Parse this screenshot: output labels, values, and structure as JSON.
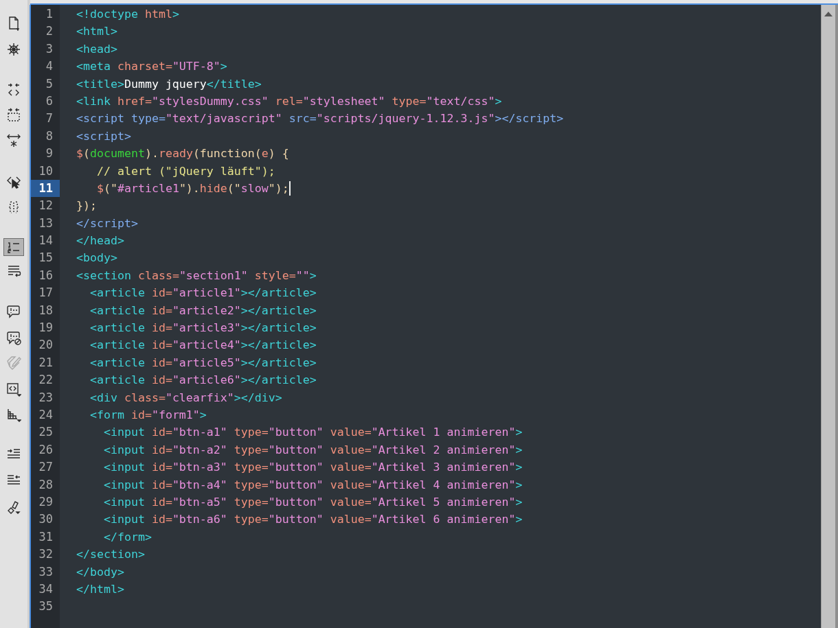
{
  "toolbar": [
    {
      "selected": false,
      "disabled": false
    },
    {
      "selected": false,
      "disabled": false
    },
    {
      "selected": false,
      "disabled": false
    },
    {
      "selected": false,
      "disabled": false
    },
    {
      "selected": false,
      "disabled": false
    },
    {
      "selected": false,
      "disabled": false
    },
    {
      "selected": false,
      "disabled": false
    },
    {
      "selected": true,
      "disabled": false
    },
    {
      "selected": false,
      "disabled": false
    },
    {
      "selected": false,
      "disabled": false
    },
    {
      "selected": false,
      "disabled": false
    },
    {
      "selected": false,
      "disabled": true
    },
    {
      "selected": false,
      "disabled": false
    },
    {
      "selected": false,
      "disabled": false
    },
    {
      "selected": false,
      "disabled": false
    },
    {
      "selected": false,
      "disabled": false
    },
    {
      "selected": false,
      "disabled": false
    }
  ],
  "lines": [
    {
      "number": "1",
      "selected": false,
      "tokens": [
        {
          "text": "<!doctype",
          "kind": "tag"
        },
        {
          "text": " html",
          "kind": "attr"
        },
        {
          "text": ">",
          "kind": "tag"
        }
      ]
    },
    {
      "number": "2",
      "selected": false,
      "tokens": [
        {
          "text": "<html>",
          "kind": "tag"
        }
      ]
    },
    {
      "number": "3",
      "selected": false,
      "tokens": [
        {
          "text": "<head>",
          "kind": "tag"
        }
      ]
    },
    {
      "number": "4",
      "selected": false,
      "tokens": [
        {
          "text": "<meta",
          "kind": "tag"
        },
        {
          "text": " charset=",
          "kind": "attr"
        },
        {
          "text": "\"UTF-8\"",
          "kind": "str"
        },
        {
          "text": ">",
          "kind": "tag"
        }
      ]
    },
    {
      "number": "5",
      "selected": false,
      "tokens": [
        {
          "text": "<title>",
          "kind": "tag"
        },
        {
          "text": "Dummy jquery",
          "kind": "plain"
        },
        {
          "text": "</title>",
          "kind": "tag"
        }
      ]
    },
    {
      "number": "6",
      "selected": false,
      "tokens": [
        {
          "text": "<link",
          "kind": "tag"
        },
        {
          "text": " href=",
          "kind": "attr"
        },
        {
          "text": "\"stylesDummy.css\"",
          "kind": "str"
        },
        {
          "text": " rel=",
          "kind": "attr"
        },
        {
          "text": "\"stylesheet\"",
          "kind": "str"
        },
        {
          "text": " type=",
          "kind": "attr"
        },
        {
          "text": "\"text/css\"",
          "kind": "str"
        },
        {
          "text": ">",
          "kind": "tag"
        }
      ]
    },
    {
      "number": "7",
      "selected": false,
      "tokens": [
        {
          "text": "<script type=",
          "kind": "script"
        },
        {
          "text": "\"text/javascript\"",
          "kind": "str"
        },
        {
          "text": " src=",
          "kind": "script"
        },
        {
          "text": "\"scripts/jquery-1.12.3.js\"",
          "kind": "str"
        },
        {
          "text": "></script>",
          "kind": "script"
        }
      ]
    },
    {
      "number": "8",
      "selected": false,
      "tokens": [
        {
          "text": "<script>",
          "kind": "script"
        }
      ]
    },
    {
      "number": "9",
      "selected": false,
      "tokens": [
        {
          "text": "$",
          "kind": "ident"
        },
        {
          "text": "(",
          "kind": "js"
        },
        {
          "text": "document",
          "kind": "dom"
        },
        {
          "text": ").",
          "kind": "js"
        },
        {
          "text": "ready",
          "kind": "ident"
        },
        {
          "text": "(function(",
          "kind": "js"
        },
        {
          "text": "e",
          "kind": "ident"
        },
        {
          "text": ") {",
          "kind": "js"
        }
      ]
    },
    {
      "number": "10",
      "selected": false,
      "tokens": [
        {
          "text": "   // alert (\"jQuery läuft\");",
          "kind": "comment"
        }
      ]
    },
    {
      "number": "11",
      "selected": true,
      "tokens": [
        {
          "text": "   $",
          "kind": "ident"
        },
        {
          "text": "(\"",
          "kind": "js"
        },
        {
          "text": "#article1",
          "kind": "str"
        },
        {
          "text": "\").",
          "kind": "js"
        },
        {
          "text": "hide",
          "kind": "ident"
        },
        {
          "text": "(\"",
          "kind": "js"
        },
        {
          "text": "slow",
          "kind": "str"
        },
        {
          "text": "\");",
          "kind": "js"
        }
      ]
    },
    {
      "number": "12",
      "selected": false,
      "tokens": [
        {
          "text": "});",
          "kind": "js"
        }
      ]
    },
    {
      "number": "13",
      "selected": false,
      "tokens": [
        {
          "text": "</script>",
          "kind": "script"
        }
      ]
    },
    {
      "number": "14",
      "selected": false,
      "tokens": [
        {
          "text": "</head>",
          "kind": "tag"
        }
      ]
    },
    {
      "number": "15",
      "selected": false,
      "tokens": [
        {
          "text": "<body>",
          "kind": "tag"
        }
      ]
    },
    {
      "number": "16",
      "selected": false,
      "tokens": [
        {
          "text": "<section",
          "kind": "tag"
        },
        {
          "text": " class=",
          "kind": "attr"
        },
        {
          "text": "\"section1\"",
          "kind": "str"
        },
        {
          "text": " style=",
          "kind": "attr"
        },
        {
          "text": "\"\"",
          "kind": "str"
        },
        {
          "text": ">",
          "kind": "tag"
        }
      ]
    },
    {
      "number": "17",
      "selected": false,
      "tokens": [
        {
          "text": "  <article",
          "kind": "tag"
        },
        {
          "text": " id=",
          "kind": "attr"
        },
        {
          "text": "\"article1\"",
          "kind": "str"
        },
        {
          "text": "></article>",
          "kind": "tag"
        }
      ]
    },
    {
      "number": "18",
      "selected": false,
      "tokens": [
        {
          "text": "  <article",
          "kind": "tag"
        },
        {
          "text": " id=",
          "kind": "attr"
        },
        {
          "text": "\"article2\"",
          "kind": "str"
        },
        {
          "text": "></article>",
          "kind": "tag"
        }
      ]
    },
    {
      "number": "19",
      "selected": false,
      "tokens": [
        {
          "text": "  <article",
          "kind": "tag"
        },
        {
          "text": " id=",
          "kind": "attr"
        },
        {
          "text": "\"article3\"",
          "kind": "str"
        },
        {
          "text": "></article>",
          "kind": "tag"
        }
      ]
    },
    {
      "number": "20",
      "selected": false,
      "tokens": [
        {
          "text": "  <article",
          "kind": "tag"
        },
        {
          "text": " id=",
          "kind": "attr"
        },
        {
          "text": "\"article4\"",
          "kind": "str"
        },
        {
          "text": "></article>",
          "kind": "tag"
        }
      ]
    },
    {
      "number": "21",
      "selected": false,
      "tokens": [
        {
          "text": "  <article",
          "kind": "tag"
        },
        {
          "text": " id=",
          "kind": "attr"
        },
        {
          "text": "\"article5\"",
          "kind": "str"
        },
        {
          "text": "></article>",
          "kind": "tag"
        }
      ]
    },
    {
      "number": "22",
      "selected": false,
      "tokens": [
        {
          "text": "  <article",
          "kind": "tag"
        },
        {
          "text": " id=",
          "kind": "attr"
        },
        {
          "text": "\"article6\"",
          "kind": "str"
        },
        {
          "text": "></article>",
          "kind": "tag"
        }
      ]
    },
    {
      "number": "23",
      "selected": false,
      "tokens": [
        {
          "text": "  <div",
          "kind": "tag"
        },
        {
          "text": " class=",
          "kind": "attr"
        },
        {
          "text": "\"clearfix\"",
          "kind": "str"
        },
        {
          "text": "></div>",
          "kind": "tag"
        }
      ]
    },
    {
      "number": "24",
      "selected": false,
      "tokens": [
        {
          "text": "  <form",
          "kind": "tag"
        },
        {
          "text": " id=",
          "kind": "attr"
        },
        {
          "text": "\"form1\"",
          "kind": "str"
        },
        {
          "text": ">",
          "kind": "tag"
        }
      ]
    },
    {
      "number": "25",
      "selected": false,
      "tokens": [
        {
          "text": "    <input",
          "kind": "tag"
        },
        {
          "text": " id=",
          "kind": "attr"
        },
        {
          "text": "\"btn-a1\"",
          "kind": "str"
        },
        {
          "text": " type=",
          "kind": "attr"
        },
        {
          "text": "\"button\"",
          "kind": "str"
        },
        {
          "text": " value=",
          "kind": "attr"
        },
        {
          "text": "\"Artikel 1 animieren\"",
          "kind": "str"
        },
        {
          "text": ">",
          "kind": "tag"
        }
      ]
    },
    {
      "number": "26",
      "selected": false,
      "tokens": [
        {
          "text": "    <input",
          "kind": "tag"
        },
        {
          "text": " id=",
          "kind": "attr"
        },
        {
          "text": "\"btn-a2\"",
          "kind": "str"
        },
        {
          "text": " type=",
          "kind": "attr"
        },
        {
          "text": "\"button\"",
          "kind": "str"
        },
        {
          "text": " value=",
          "kind": "attr"
        },
        {
          "text": "\"Artikel 2 animieren\"",
          "kind": "str"
        },
        {
          "text": ">",
          "kind": "tag"
        }
      ]
    },
    {
      "number": "27",
      "selected": false,
      "tokens": [
        {
          "text": "    <input",
          "kind": "tag"
        },
        {
          "text": " id=",
          "kind": "attr"
        },
        {
          "text": "\"btn-a3\"",
          "kind": "str"
        },
        {
          "text": " type=",
          "kind": "attr"
        },
        {
          "text": "\"button\"",
          "kind": "str"
        },
        {
          "text": " value=",
          "kind": "attr"
        },
        {
          "text": "\"Artikel 3 animieren\"",
          "kind": "str"
        },
        {
          "text": ">",
          "kind": "tag"
        }
      ]
    },
    {
      "number": "28",
      "selected": false,
      "tokens": [
        {
          "text": "    <input",
          "kind": "tag"
        },
        {
          "text": " id=",
          "kind": "attr"
        },
        {
          "text": "\"btn-a4\"",
          "kind": "str"
        },
        {
          "text": " type=",
          "kind": "attr"
        },
        {
          "text": "\"button\"",
          "kind": "str"
        },
        {
          "text": " value=",
          "kind": "attr"
        },
        {
          "text": "\"Artikel 4 animieren\"",
          "kind": "str"
        },
        {
          "text": ">",
          "kind": "tag"
        }
      ]
    },
    {
      "number": "29",
      "selected": false,
      "tokens": [
        {
          "text": "    <input",
          "kind": "tag"
        },
        {
          "text": " id=",
          "kind": "attr"
        },
        {
          "text": "\"btn-a5\"",
          "kind": "str"
        },
        {
          "text": " type=",
          "kind": "attr"
        },
        {
          "text": "\"button\"",
          "kind": "str"
        },
        {
          "text": " value=",
          "kind": "attr"
        },
        {
          "text": "\"Artikel 5 animieren\"",
          "kind": "str"
        },
        {
          "text": ">",
          "kind": "tag"
        }
      ]
    },
    {
      "number": "30",
      "selected": false,
      "tokens": [
        {
          "text": "    <input",
          "kind": "tag"
        },
        {
          "text": " id=",
          "kind": "attr"
        },
        {
          "text": "\"btn-a6\"",
          "kind": "str"
        },
        {
          "text": " type=",
          "kind": "attr"
        },
        {
          "text": "\"button\"",
          "kind": "str"
        },
        {
          "text": " value=",
          "kind": "attr"
        },
        {
          "text": "\"Artikel 6 animieren\"",
          "kind": "str"
        },
        {
          "text": ">",
          "kind": "tag"
        }
      ]
    },
    {
      "number": "31",
      "selected": false,
      "tokens": [
        {
          "text": "    </form>",
          "kind": "tag"
        }
      ]
    },
    {
      "number": "32",
      "selected": false,
      "tokens": [
        {
          "text": "</section>",
          "kind": "tag"
        }
      ]
    },
    {
      "number": "33",
      "selected": false,
      "tokens": [
        {
          "text": "</body>",
          "kind": "tag"
        }
      ]
    },
    {
      "number": "34",
      "selected": false,
      "tokens": [
        {
          "text": "</html>",
          "kind": "tag"
        }
      ]
    },
    {
      "number": "35",
      "selected": false
    }
  ]
}
